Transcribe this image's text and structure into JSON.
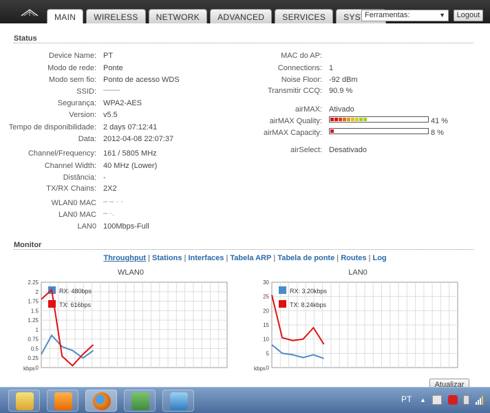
{
  "header": {
    "tabs": [
      {
        "label": "MAIN",
        "active": true
      },
      {
        "label": "WIRELESS",
        "active": false
      },
      {
        "label": "NETWORK",
        "active": false
      },
      {
        "label": "ADVANCED",
        "active": false
      },
      {
        "label": "SERVICES",
        "active": false
      },
      {
        "label": "SYSTEM",
        "active": false
      }
    ],
    "tools_select": "Ferramentas:",
    "logout_label": "Logout"
  },
  "status": {
    "title": "Status",
    "left": [
      {
        "label": "Device Name:",
        "value": "PT"
      },
      {
        "label": "Modo de rede:",
        "value": "Ponte"
      },
      {
        "label": "Modo sem fio:",
        "value": "Ponto de acesso WDS"
      },
      {
        "label": "SSID:",
        "value": "––––"
      },
      {
        "label": "Segurança:",
        "value": "WPA2-AES"
      },
      {
        "label": "Version:",
        "value": "v5.5"
      },
      {
        "label": "Tempo de disponibilidade:",
        "value": "2 days 07:12:41"
      },
      {
        "label": "Data:",
        "value": "2012-04-08 22:07:37"
      },
      {
        "label": "Channel/Frequency:",
        "value": "161 / 5805 MHz"
      },
      {
        "label": "Channel Width:",
        "value": "40 MHz (Lower)"
      },
      {
        "label": "Distância:",
        "value": "-"
      },
      {
        "label": "TX/RX Chains:",
        "value": "2X2"
      },
      {
        "label": "WLAN0 MAC",
        "value": "– –  ·   ·"
      },
      {
        "label": "LAN0 MAC",
        "value": "–          ·."
      },
      {
        "label": "LAN0",
        "value": "100Mbps-Full"
      }
    ],
    "right": [
      {
        "label": "MAC do AP:",
        "value": ""
      },
      {
        "label": "Connections:",
        "value": "1"
      },
      {
        "label": "Noise Floor:",
        "value": "-92 dBm"
      },
      {
        "label": "Transmitir CCQ:",
        "value": "90.9 %"
      },
      {
        "label": "airMAX:",
        "value": "Ativado"
      },
      {
        "label": "airMAX Quality:",
        "value": "41 %"
      },
      {
        "label": "airMAX Capacity:",
        "value": "8 %"
      },
      {
        "label": "airSelect:",
        "value": "Desativado"
      }
    ],
    "airmax_quality_level": 0.41,
    "airmax_capacity_level": 0.08
  },
  "monitor": {
    "title": "Monitor",
    "links": [
      "Throughput",
      "Stations",
      "Interfaces",
      "Tabela ARP",
      "Tabela de ponte",
      "Routes",
      "Log"
    ],
    "active_link": "Throughput",
    "refresh_label": "Atualizar"
  },
  "chart_data": [
    {
      "type": "line",
      "title": "WLAN0",
      "ylabel": "kbps",
      "ylim": [
        0,
        2.25
      ],
      "yticks": [
        "2.25",
        "2",
        "1.75",
        "1.5",
        "1.25",
        "1",
        "0.75",
        "0.5",
        "0.25",
        "0"
      ],
      "legend_position": "top-left",
      "series": [
        {
          "name": "RX: 480bps",
          "color": "#4a8cc8",
          "values": [
            0.35,
            0.85,
            0.55,
            0.45,
            0.25,
            0.45
          ]
        },
        {
          "name": "TX: 616bps",
          "color": "#e01010",
          "values": [
            1.8,
            2.05,
            0.3,
            0.05,
            0.35,
            0.6
          ]
        }
      ]
    },
    {
      "type": "line",
      "title": "LAN0",
      "ylabel": "kbps",
      "ylim": [
        0,
        30
      ],
      "yticks": [
        "30",
        "25",
        "20",
        "15",
        "10",
        "5",
        "0"
      ],
      "legend_position": "top-left",
      "series": [
        {
          "name": "RX: 3.20kbps",
          "color": "#4a8cc8",
          "values": [
            8,
            5,
            4.5,
            3.5,
            4.5,
            3.2
          ]
        },
        {
          "name": "TX: 8.24kbps",
          "color": "#e01010",
          "values": [
            25.5,
            10.5,
            9.5,
            10,
            14,
            8.2
          ]
        }
      ]
    }
  ],
  "taskbar": {
    "lang": "PT",
    "tray_arrow": "▲"
  }
}
